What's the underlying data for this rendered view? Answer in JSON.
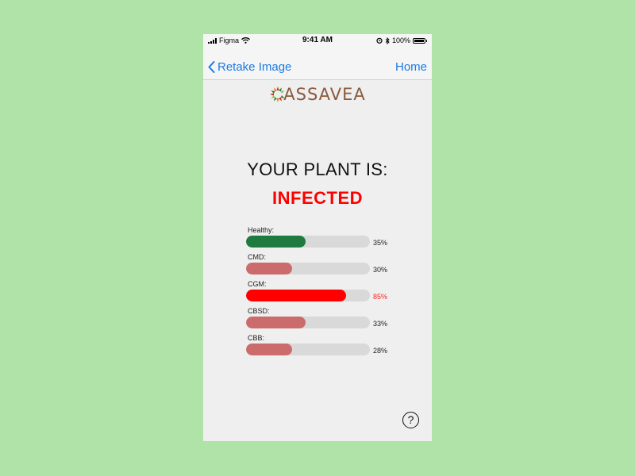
{
  "status_bar": {
    "carrier": "Figma",
    "time": "9:41 AM",
    "battery": "100%"
  },
  "nav": {
    "back_label": "Retake Image",
    "home_label": "Home"
  },
  "logo": {
    "text": "ASSAVEA"
  },
  "result": {
    "heading": "YOUR PLANT IS:",
    "status": "INFECTED",
    "status_color": "#ff0000"
  },
  "scores": [
    {
      "label": "Healthy:",
      "value": "35%",
      "fraction": 0.48,
      "color": "#1e7a3e",
      "text_color": "#222222"
    },
    {
      "label": "CMD:",
      "value": "30%",
      "fraction": 0.37,
      "color": "#cc6b6b",
      "text_color": "#222222"
    },
    {
      "label": "CGM:",
      "value": "85%",
      "fraction": 0.81,
      "color": "#ff0000",
      "text_color": "#ff2020"
    },
    {
      "label": "CBSD:",
      "value": "33%",
      "fraction": 0.48,
      "color": "#cc6b6b",
      "text_color": "#222222"
    },
    {
      "label": "CBB:",
      "value": "28%",
      "fraction": 0.37,
      "color": "#cc6b6b",
      "text_color": "#222222"
    }
  ],
  "help": {
    "label": "?"
  },
  "colors": {
    "background": "#b0e3a8",
    "link": "#1a7ae6",
    "logo_brown": "#8a5a3c"
  }
}
